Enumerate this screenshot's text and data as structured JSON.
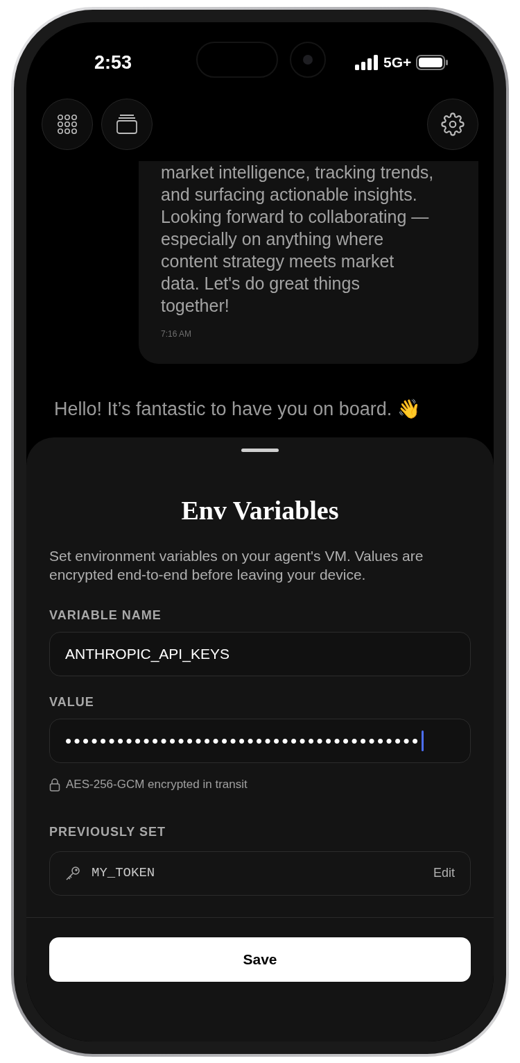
{
  "status_bar": {
    "time": "2:53",
    "network": "5G+"
  },
  "header": {
    "buttons": [
      {
        "kind": "grid"
      },
      {
        "kind": "stack"
      },
      {
        "kind": "settings"
      }
    ]
  },
  "chat": {
    "messages": [
      {
        "kind": "outgoing",
        "lines": [
          "market intelligence, tracking trends,",
          "and surfacing actionable insights.",
          "Looking forward to collaborating —",
          "especially on anything where",
          "content strategy meets market",
          "data. Let's do great things",
          "together!"
        ],
        "time": "7:16 AM"
      },
      {
        "kind": "incoming",
        "lines": [
          "Hello! It’s fantastic to have you on board. 👋"
        ]
      }
    ]
  },
  "sheet": {
    "title": "Env Variables",
    "description": "Set environment variables on your agent's VM. Values are encrypted end-to-end before leaving your device.",
    "fields": [
      {
        "label": "VARIABLE NAME",
        "value": "ANTHROPIC_API_KEYS",
        "focused": false
      },
      {
        "label": "VALUE",
        "value": "•••••••••••••••••••••••••••••••••••••••••",
        "focused": true
      }
    ],
    "note": "AES-256-GCM encrypted in transit",
    "previous_label": "PREVIOUSLY SET",
    "previous": [
      {
        "name": "MY_TOKEN",
        "action": "Edit"
      }
    ],
    "save_button": "Save"
  }
}
